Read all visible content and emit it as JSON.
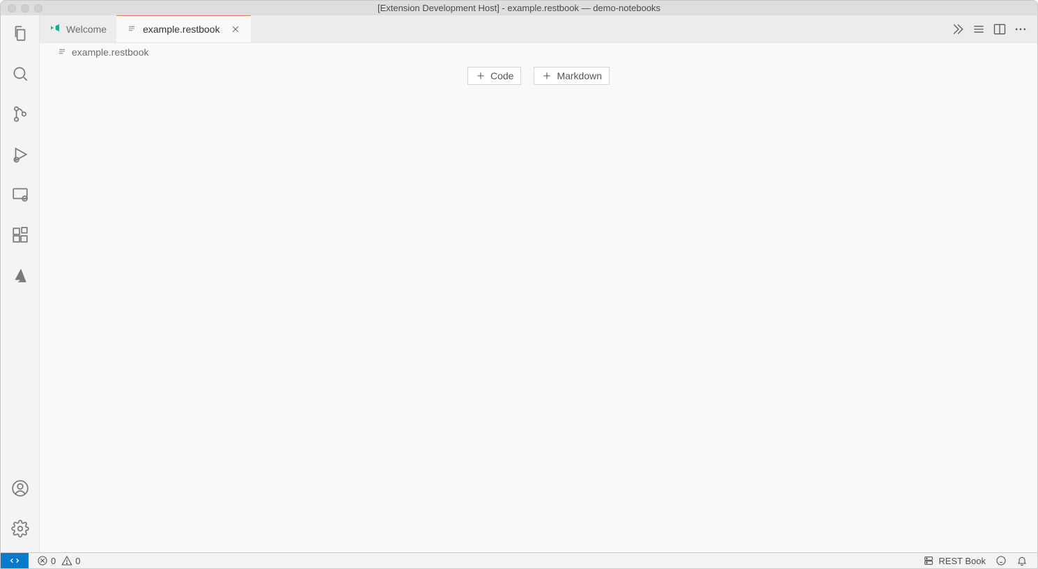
{
  "window": {
    "title": "[Extension Development Host] - example.restbook — demo-notebooks"
  },
  "tabs": [
    {
      "label": "Welcome",
      "active": false,
      "icon": "vscode-icon",
      "closable": false
    },
    {
      "label": "example.restbook",
      "active": true,
      "icon": "file-icon",
      "closable": true
    }
  ],
  "tabbar_actions": {
    "run_all": "run-all-icon",
    "clear_outputs": "clear-outputs-icon",
    "split_editor": "split-editor-icon",
    "more": "more-icon"
  },
  "breadcrumbs": {
    "file": "example.restbook"
  },
  "add_cell": {
    "code_label": "Code",
    "markdown_label": "Markdown"
  },
  "statusbar": {
    "errors": "0",
    "warnings": "0",
    "kernel": "REST Book"
  },
  "activitybar": {
    "top": [
      "explorer",
      "search",
      "source-control",
      "run-debug",
      "remote-explorer",
      "extensions",
      "azure"
    ],
    "bottom": [
      "accounts",
      "settings"
    ]
  }
}
